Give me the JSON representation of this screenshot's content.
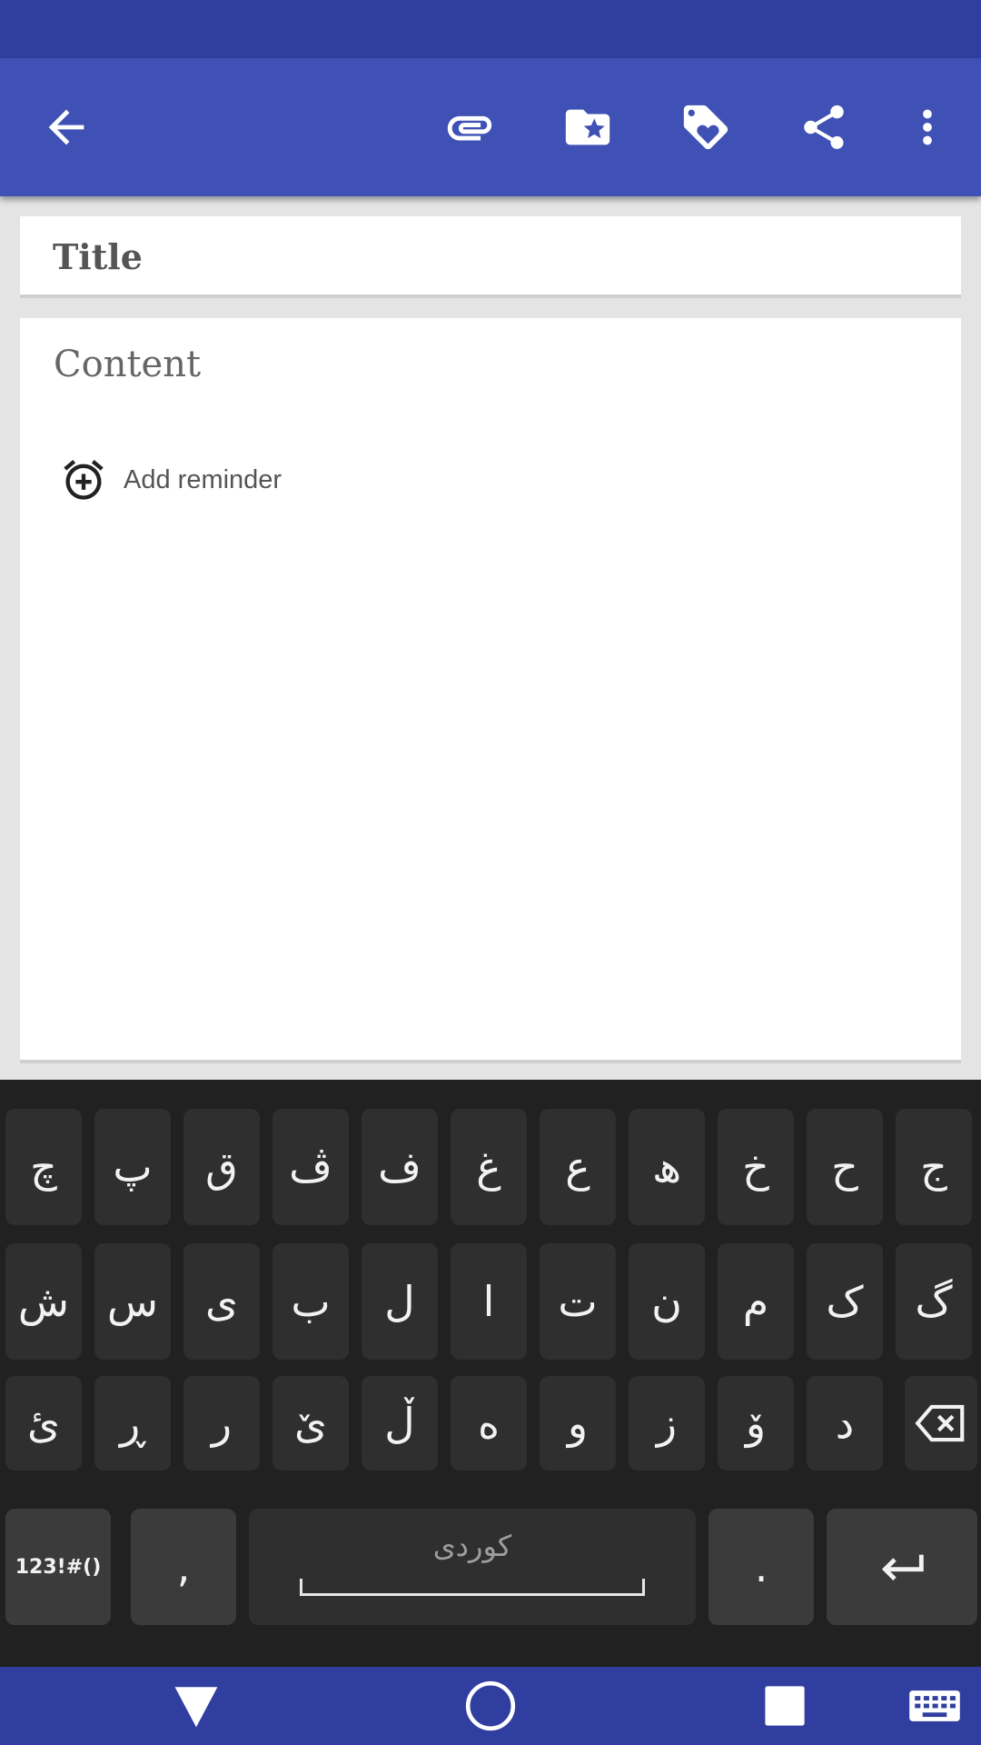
{
  "app_bar": {
    "icons": [
      "back-arrow-icon",
      "attachment-icon",
      "folder-star-icon",
      "tag-heart-icon",
      "share-icon",
      "more-vert-icon"
    ]
  },
  "note": {
    "title_placeholder": "Title",
    "content_placeholder": "Content",
    "reminder_label": "Add reminder"
  },
  "keyboard": {
    "row1": [
      "چ",
      "پ",
      "ق",
      "ڤ",
      "ف",
      "غ",
      "ع",
      "ھ",
      "خ",
      "ح",
      "ج"
    ],
    "row2": [
      "ش",
      "س",
      "ی",
      "ب",
      "ل",
      "ا",
      "ت",
      "ن",
      "م",
      "ک",
      "گ"
    ],
    "row3": [
      "ئ",
      "ڕ",
      "ر",
      "ێ",
      "ڵ",
      "ە",
      "و",
      "ز",
      "ۆ",
      "د"
    ],
    "symbols_label": "123!#()",
    "comma_label": ",",
    "space_label": "کوردی",
    "period_label": ".",
    "backspace_icon": "backspace-icon",
    "enter_icon": "enter-icon"
  },
  "nav_bar": {
    "icons": [
      "back-triangle-icon",
      "home-circle-icon",
      "recents-square-icon",
      "keyboard-icon"
    ]
  },
  "colors": {
    "status_bar": "#303f9f",
    "app_bar": "#3f51b5",
    "keyboard_bg": "#212121",
    "key_bg": "#2f2f2f"
  }
}
